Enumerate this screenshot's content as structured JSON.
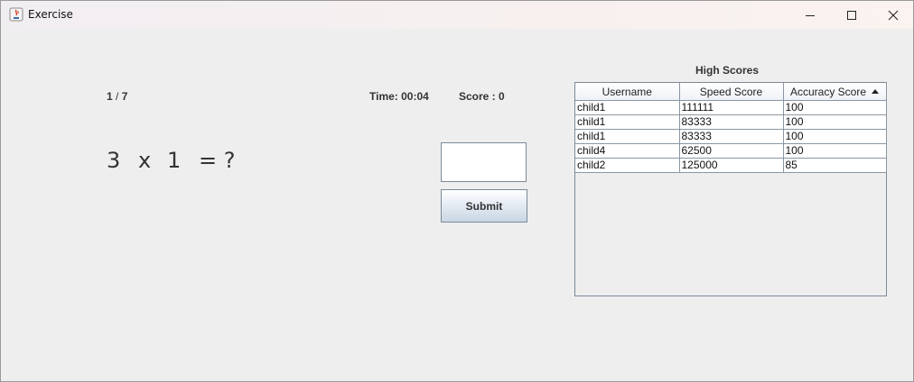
{
  "window": {
    "title": "Exercise"
  },
  "progress": {
    "current": "1",
    "sep": " / ",
    "total": "7"
  },
  "timer": "Time: 00:04",
  "score": "Score : 0",
  "question": {
    "a": "3",
    "op": "x",
    "b": "1",
    "eq": "= ?"
  },
  "answer": {
    "value": ""
  },
  "submit_label": "Submit",
  "high_scores": {
    "title": "High Scores",
    "columns": [
      "Username",
      "Speed Score",
      "Accuracy Score"
    ],
    "rows": [
      [
        "child1",
        "111111",
        "100"
      ],
      [
        "child1",
        "83333",
        "100"
      ],
      [
        "child1",
        "83333",
        "100"
      ],
      [
        "child4",
        "62500",
        "100"
      ],
      [
        "child2",
        "125000",
        "85"
      ]
    ]
  }
}
